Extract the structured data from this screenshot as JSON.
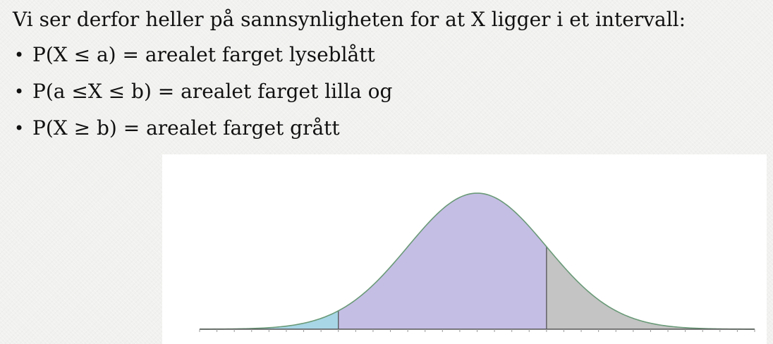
{
  "intro": "Vi ser derfor heller på sannsynligheten for at X ligger i et intervall:",
  "bullets": [
    {
      "text": "P(X ≤ a) = arealet farget lyseblått"
    },
    {
      "text": "P(a ≤X ≤ b) = arealet farget lilla og"
    },
    {
      "text": "P(X ≥ b) = arealet farget grått"
    }
  ],
  "chart_data": {
    "type": "area",
    "distribution": "normal",
    "x_range": [
      -4,
      4
    ],
    "mean": 0,
    "sd": 1,
    "a": -2,
    "b": 1,
    "regions": [
      {
        "name": "P(X ≤ a)",
        "from": -4,
        "to": -2,
        "color": "#a8d6e6"
      },
      {
        "name": "P(a ≤ X ≤ b)",
        "from": -2,
        "to": 1,
        "color": "#c5bee4"
      },
      {
        "name": "P(X ≥ b)",
        "from": 1,
        "to": 4,
        "color": "#c4c4c4"
      }
    ],
    "curve_color": "#6a9a78",
    "axis_color": "#555555",
    "tick_step": 0.25
  }
}
